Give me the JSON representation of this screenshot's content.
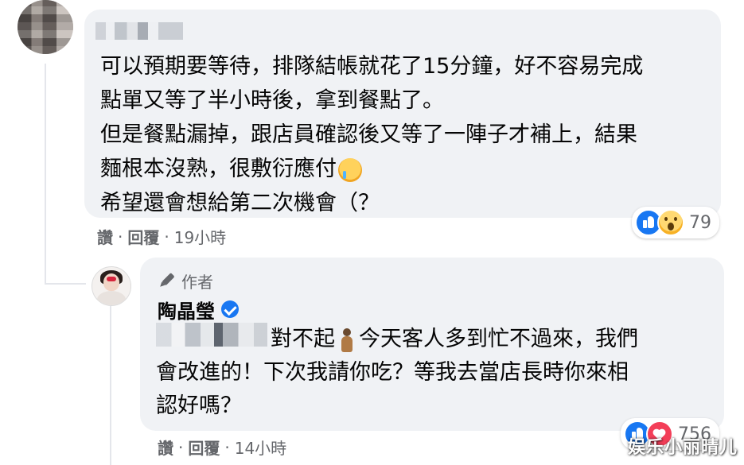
{
  "comment": {
    "text": "可以預期要等待，排隊結帳就花了15分鐘，好不容易完成\n點單又等了半小時後，拿到餐點了。\n但是餐點漏掉，跟店員確認後又等了一陣子才補上，結果\n麵根本沒熟，很敷衍應付",
    "text_end": "\n希望還會想給第二次機會（？",
    "actions": {
      "like": "讚",
      "reply": "回覆",
      "separator": "·",
      "time": "19小時"
    },
    "reactions_count": "79",
    "reaction_icons": [
      "like-icon",
      "wow-icon"
    ]
  },
  "reply": {
    "badge": "作者",
    "author": "陶晶瑩",
    "text_part1": "對不起",
    "text_part2": "今天客人多到忙不過來，我們\n會改進的！下次我請你吃？等我去當店長時你來相\n認好嗎？",
    "actions": {
      "like": "讚",
      "reply": "回覆",
      "separator": "·",
      "time": "14小時"
    },
    "reactions_count": "756",
    "reaction_icons": [
      "like-icon",
      "love-icon"
    ]
  },
  "watermark": "娱乐小丽晴儿"
}
